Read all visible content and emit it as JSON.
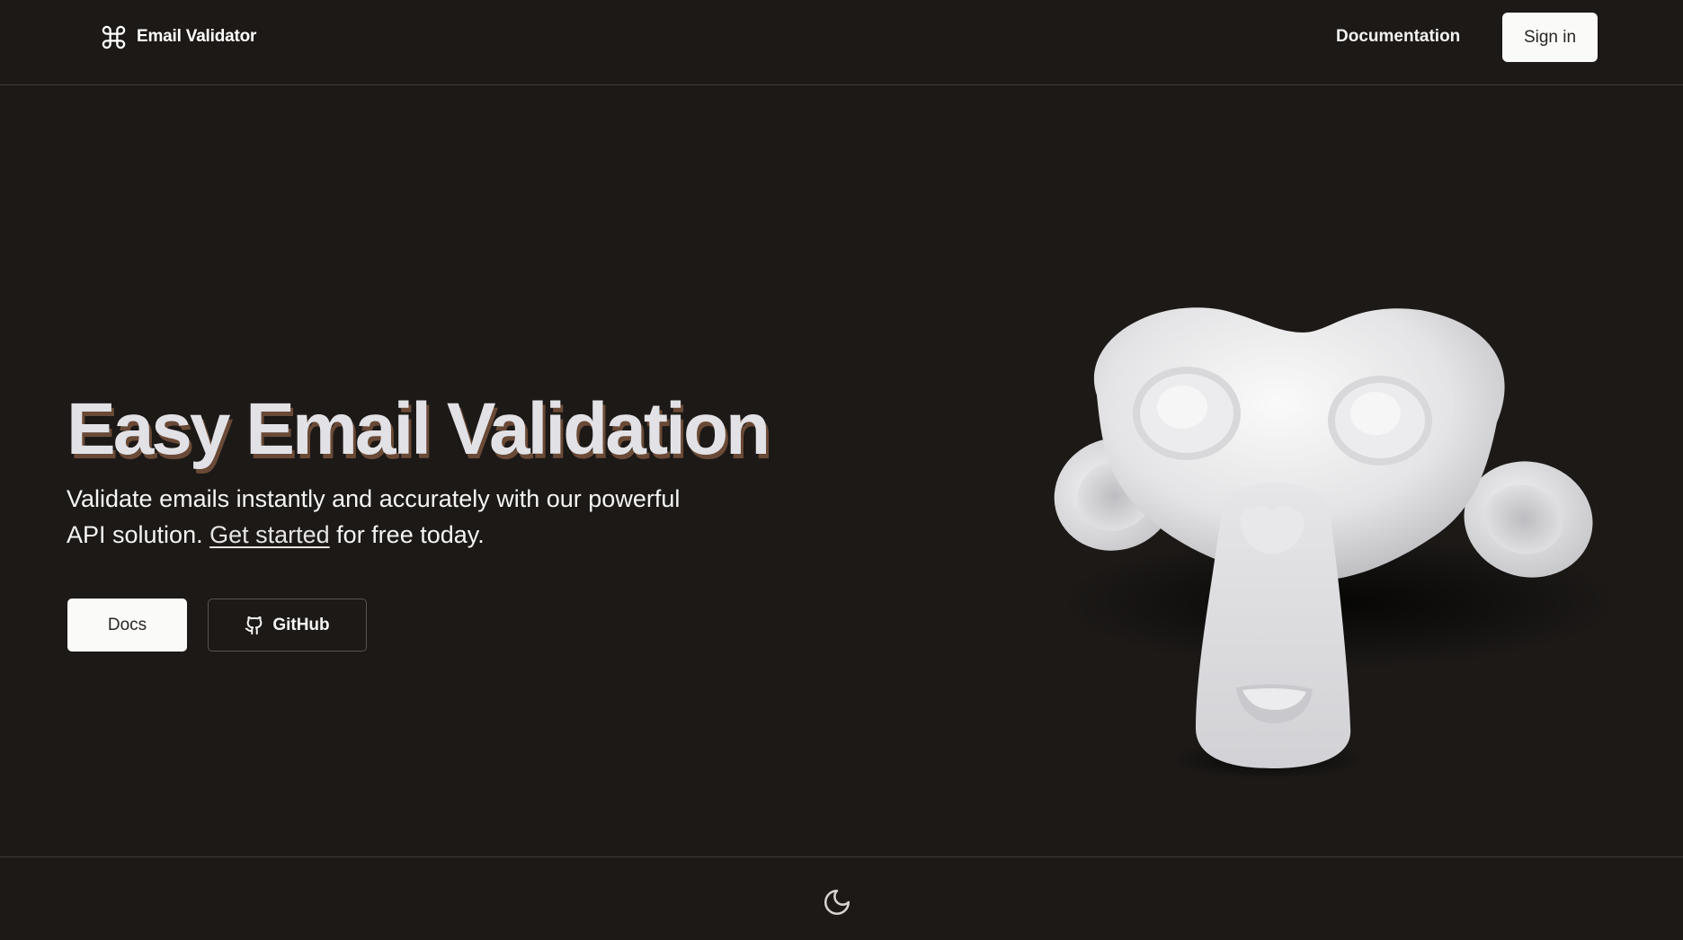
{
  "header": {
    "brand_name": "Email Validator",
    "brand_icon": "command-icon",
    "nav": {
      "documentation_label": "Documentation"
    },
    "signin_label": "Sign in"
  },
  "hero": {
    "title": "Easy Email Validation",
    "subtitle_before": "Validate emails instantly and accurately with our powerful API solution. ",
    "subtitle_link": "Get started",
    "subtitle_after": " for free today.",
    "docs_button": "Docs",
    "github_button": "GitHub",
    "github_icon": "github-icon",
    "illustration": "monkey-head-3d-render"
  },
  "footer": {
    "theme_toggle_icon": "moon-icon"
  },
  "colors": {
    "background": "#1c1917",
    "button_light": "#fafaf9",
    "title_shadow": "#6a4a36",
    "divider": "#3f3b38"
  }
}
